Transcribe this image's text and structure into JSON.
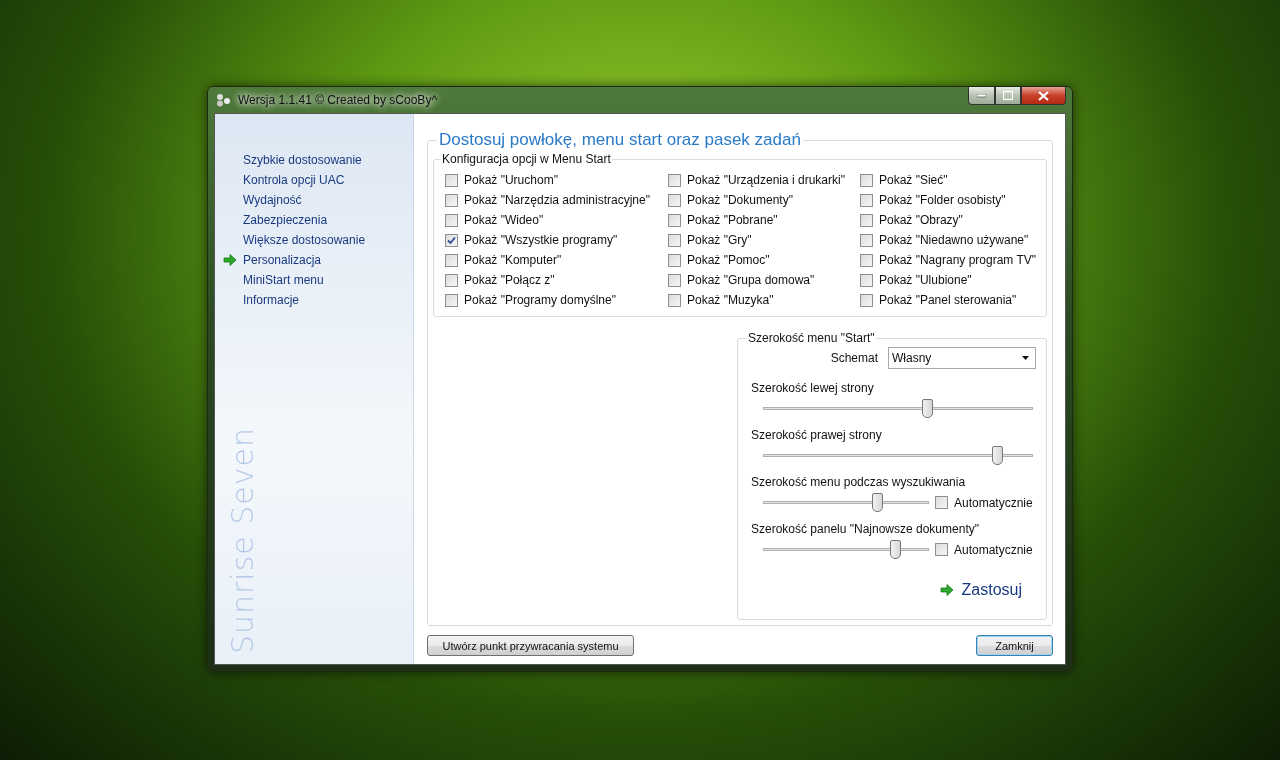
{
  "window": {
    "title": "Wersja 1.1.41 © Created by sCooBy^"
  },
  "sidebar": {
    "items": [
      {
        "label": "Szybkie dostosowanie",
        "selected": false
      },
      {
        "label": "Kontrola opcji UAC",
        "selected": false
      },
      {
        "label": "Wydajność",
        "selected": false
      },
      {
        "label": "Zabezpieczenia",
        "selected": false
      },
      {
        "label": "Większe dostosowanie",
        "selected": false
      },
      {
        "label": "Personalizacja",
        "selected": true
      },
      {
        "label": "MiniStart menu",
        "selected": false
      },
      {
        "label": "Informacje",
        "selected": false
      }
    ],
    "brand": "Sunrise Seven"
  },
  "panel": {
    "title": "Dostosuj powłokę, menu start oraz pasek zadań",
    "start_menu_options": {
      "title": "Konfiguracja opcji w Menu Start",
      "options": [
        {
          "label": "Pokaż \"Uruchom\"",
          "checked": false
        },
        {
          "label": "Pokaż \"Narzędzia administracyjne\"",
          "checked": false
        },
        {
          "label": "Pokaż \"Wideo\"",
          "checked": false
        },
        {
          "label": "Pokaż \"Wszystkie programy\"",
          "checked": true
        },
        {
          "label": "Pokaż \"Komputer\"",
          "checked": false
        },
        {
          "label": "Pokaż \"Połącz z\"",
          "checked": false
        },
        {
          "label": "Pokaż \"Programy domyślne\"",
          "checked": false
        },
        {
          "label": "Pokaż \"Urządzenia i drukarki\"",
          "checked": false
        },
        {
          "label": "Pokaż \"Dokumenty\"",
          "checked": false
        },
        {
          "label": "Pokaż \"Pobrane\"",
          "checked": false
        },
        {
          "label": "Pokaż \"Gry\"",
          "checked": false
        },
        {
          "label": "Pokaż \"Pomoc\"",
          "checked": false
        },
        {
          "label": "Pokaż \"Grupa domowa\"",
          "checked": false
        },
        {
          "label": "Pokaż \"Muzyka\"",
          "checked": false
        },
        {
          "label": "Pokaż \"Sieć\"",
          "checked": false
        },
        {
          "label": "Pokaż \"Folder osobisty\"",
          "checked": false
        },
        {
          "label": "Pokaż \"Obrazy\"",
          "checked": false
        },
        {
          "label": "Pokaż \"Niedawno używane\"",
          "checked": false
        },
        {
          "label": "Pokaż \"Nagrany program TV\"",
          "checked": false
        },
        {
          "label": "Pokaż \"Ulubione\"",
          "checked": false
        },
        {
          "label": "Pokaż \"Panel sterowania\"",
          "checked": false
        }
      ]
    },
    "width_settings": {
      "title": "Szerokość menu \"Start\"",
      "scheme_label": "Schemat",
      "scheme_value": "Własny",
      "sliders": [
        {
          "label": "Szerokość lewej strony",
          "level": 0.61
        },
        {
          "label": "Szerokość prawej strony",
          "level": 0.87
        },
        {
          "label": "Szerokość menu podczas wyszukiwania",
          "level": 0.69,
          "auto": {
            "label": "Automatycznie",
            "checked": false
          }
        },
        {
          "label": "Szerokość panelu \"Najnowsze dokumenty\"",
          "level": 0.8,
          "auto": {
            "label": "Automatycznie",
            "checked": false
          }
        }
      ],
      "apply": "Zastosuj"
    }
  },
  "buttons": {
    "restore_point": "Utwórz punkt przywracania systemu",
    "close": "Zamknij"
  }
}
